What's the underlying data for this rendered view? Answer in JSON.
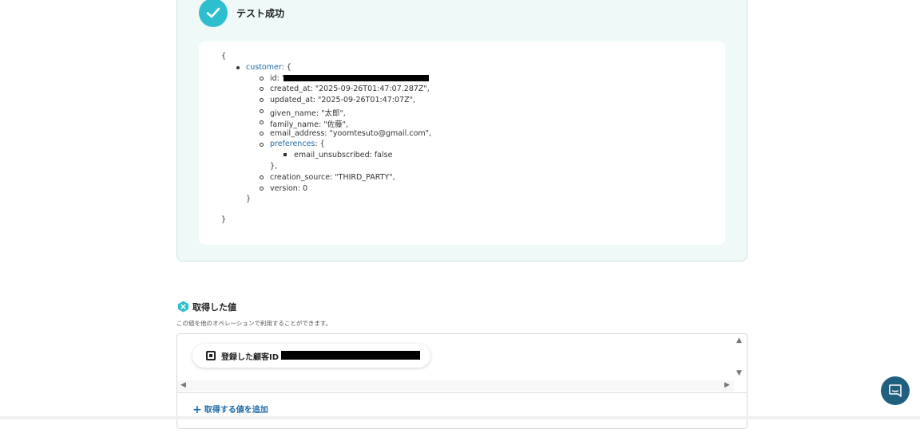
{
  "test_result": {
    "status_label": "テスト成功"
  },
  "json_view": {
    "open_brace": "{",
    "close_brace": "}",
    "customer_key": "customer",
    "customer_open": ": {",
    "id_prefix": "id: \"",
    "created_at": "created_at: \"2025-09-26T01:47:07.287Z\",",
    "updated_at": "updated_at: \"2025-09-26T01:47:07Z\",",
    "given_name": "given_name: \"太郎\",",
    "family_name": "family_name: \"佐藤\",",
    "email_address": "email_address: \"yoomtesuto@gmail.com\",",
    "preferences_key": "preferences",
    "preferences_open": ": {",
    "email_unsubscribed": "email_unsubscribed: false",
    "preferences_close": "},",
    "creation_source": "creation_source: \"THIRD_PARTY\",",
    "version": "version: 0",
    "customer_close": "}"
  },
  "acquired_values": {
    "title": "取得した値",
    "subtitle": "この値を他のオペレーションで利用することができます。",
    "items": [
      {
        "label": "登録した顧客ID"
      }
    ],
    "add_label": "取得する値を追加",
    "add_symbol": "+"
  },
  "colors": {
    "accent": "#2dbfcf",
    "link": "#1e6aa8",
    "chat_button": "#1f5f80",
    "panel_bg": "#eff9f7"
  },
  "icons": {
    "success": "check-circle-icon",
    "acquired": "badge-x-icon",
    "chip": "square-dot-icon",
    "chat": "chat-bubble-icon"
  }
}
